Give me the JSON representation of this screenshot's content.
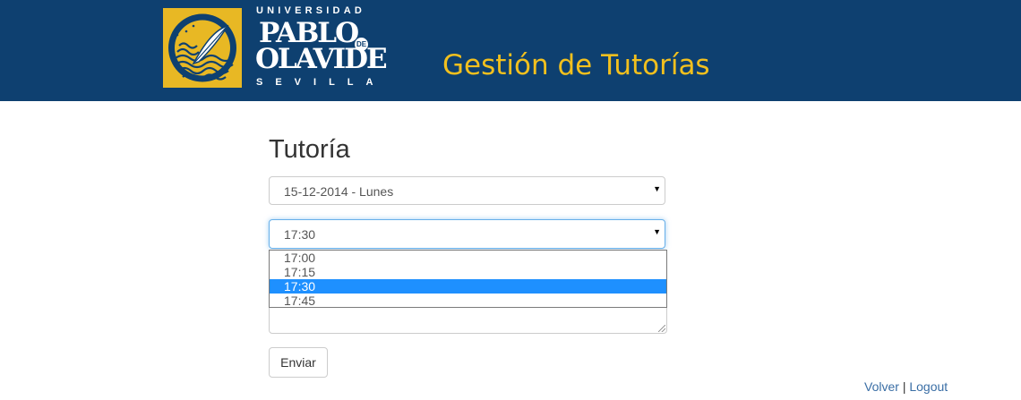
{
  "header": {
    "university_top": "UNIVERSIDAD",
    "university_name_line1": "PABLO",
    "university_name_de": "DE",
    "university_name_line2": "OLAVIDE",
    "university_city": "SEVILLA",
    "app_title": "Gestión de Tutorías",
    "colors": {
      "header_bg": "#0e4070",
      "title_color": "#f2c01e",
      "logo_gold": "#e8b824"
    }
  },
  "form": {
    "heading": "Tutoría",
    "date_select": {
      "value": "15-12-2014 - Lunes"
    },
    "time_select": {
      "value": "17:30",
      "options": [
        "17:00",
        "17:15",
        "17:30",
        "17:45"
      ],
      "selected_index": 2
    },
    "submit_label": "Enviar"
  },
  "footer": {
    "back_link": "Volver",
    "separator": "|",
    "logout_link": "Logout"
  },
  "icons": {
    "select_arrow": "dropdown-arrow-icon",
    "logo_emblem": "quill-sun-emblem-icon"
  }
}
